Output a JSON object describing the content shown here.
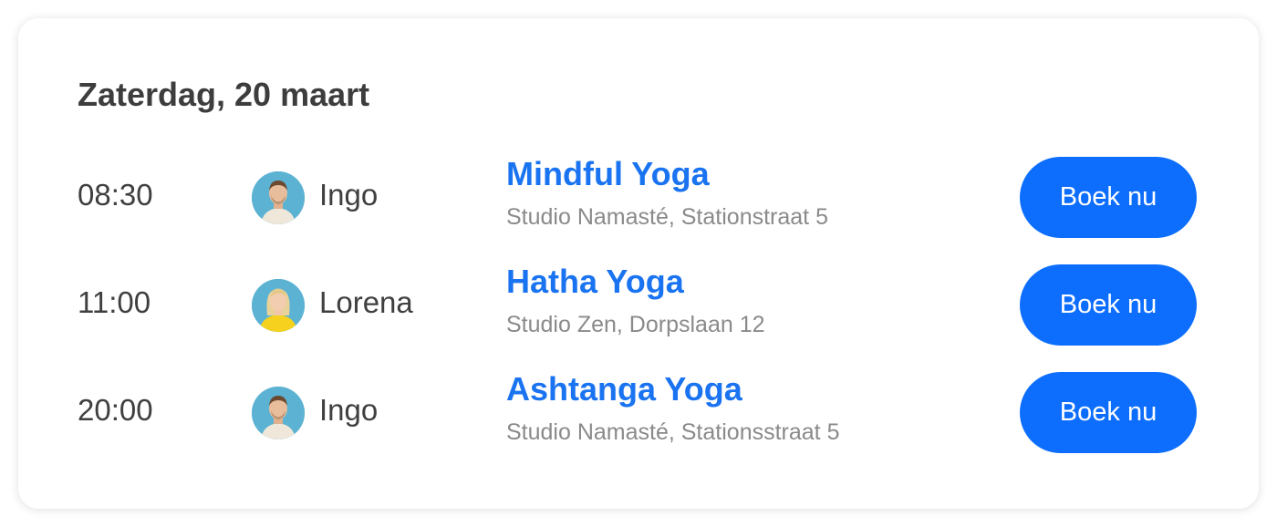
{
  "schedule": {
    "day_title": "Zaterdag, 20 maart",
    "sessions": [
      {
        "time": "08:30",
        "teacher": "Ingo",
        "avatar": "ingo",
        "class_name": "Mindful Yoga",
        "location": "Studio Namasté, Stationstraat 5",
        "button_label": "Boek nu"
      },
      {
        "time": "11:00",
        "teacher": "Lorena",
        "avatar": "lorena",
        "class_name": "Hatha Yoga",
        "location": "Studio Zen, Dorpslaan 12",
        "button_label": "Boek nu"
      },
      {
        "time": "20:00",
        "teacher": "Ingo",
        "avatar": "ingo",
        "class_name": "Ashtanga Yoga",
        "location": "Studio Namasté, Stationsstraat 5",
        "button_label": "Boek nu"
      }
    ]
  },
  "colors": {
    "accent": "#1a73f0",
    "button": "#0d6efd",
    "avatar_bg": "#5cb2d3"
  }
}
